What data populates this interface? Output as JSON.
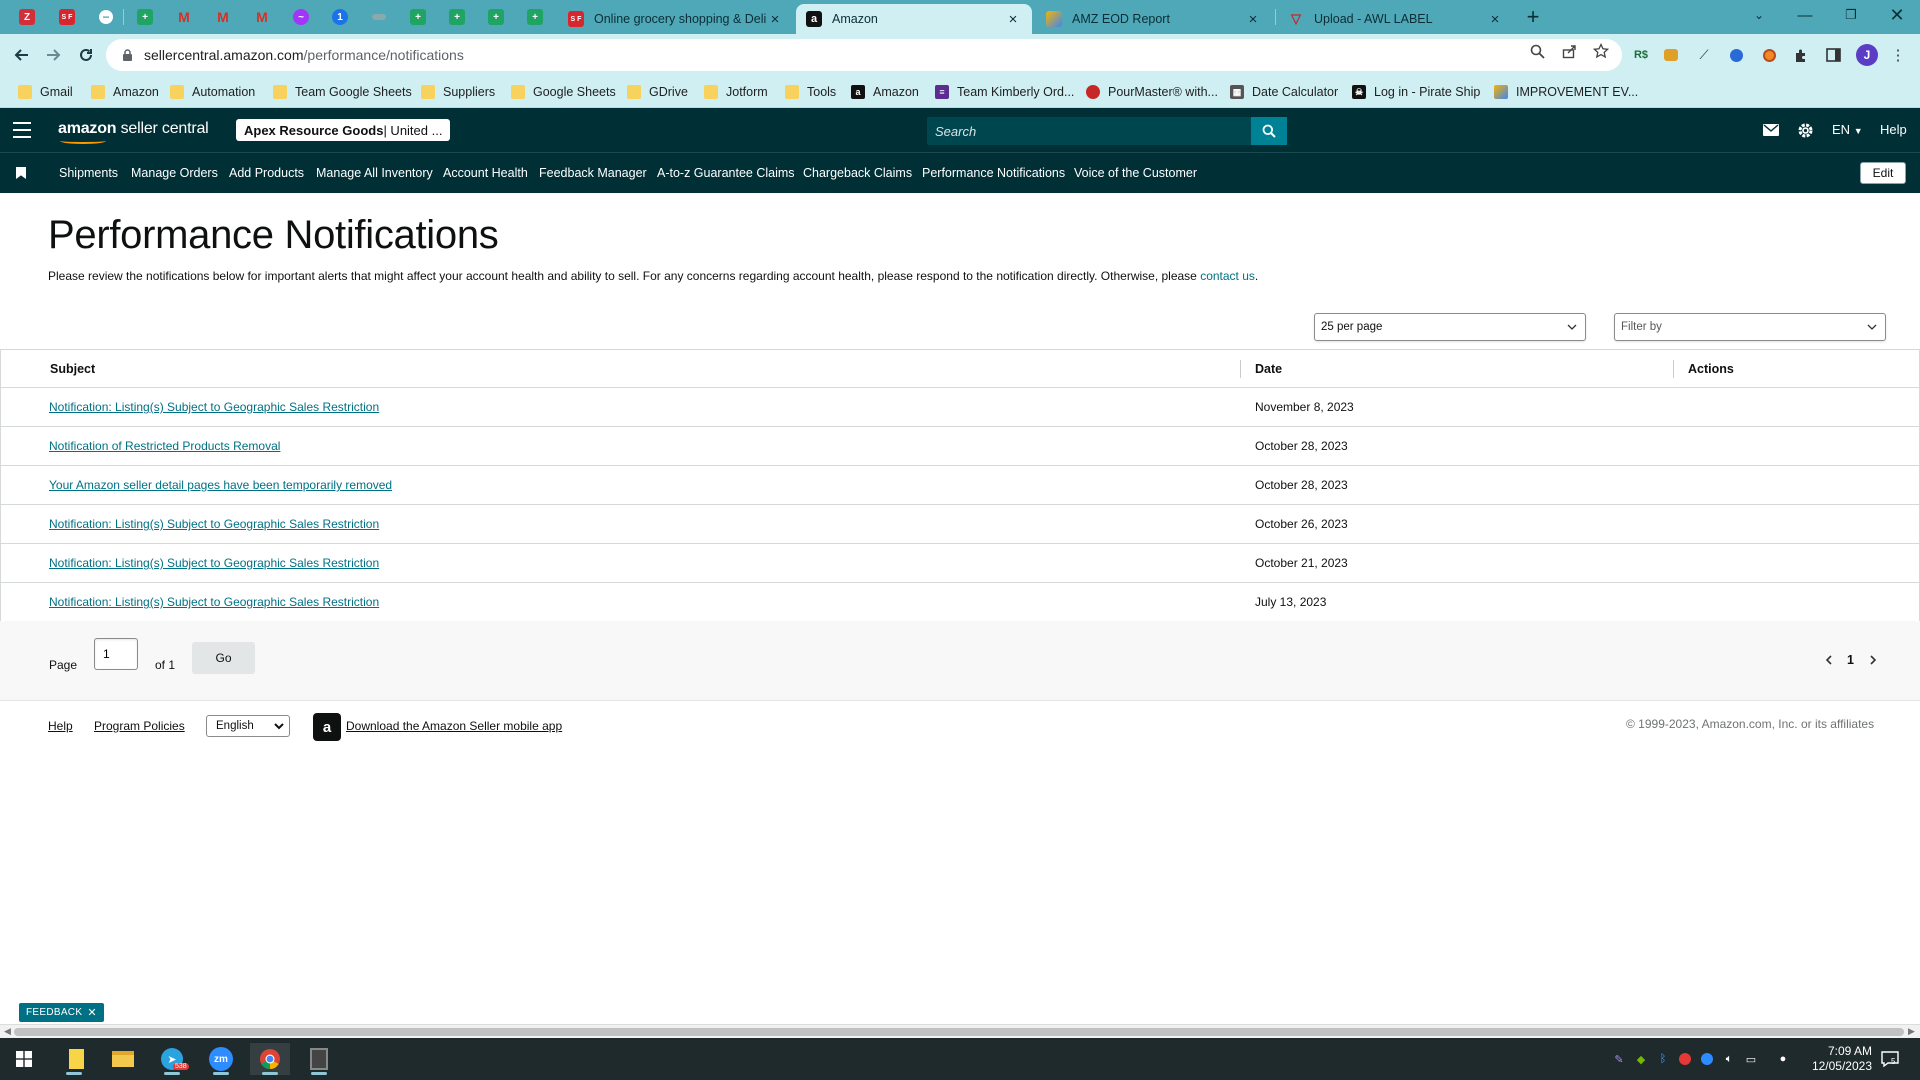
{
  "browser": {
    "tabs": [
      {
        "title": "Online grocery shopping & Deli",
        "favicon": "sf-icon"
      },
      {
        "title": "Amazon",
        "favicon": "amazon-icon",
        "active": true
      },
      {
        "title": "AMZ EOD Report",
        "favicon": "report-icon"
      },
      {
        "title": "Upload - AWL LABEL",
        "favicon": "upload-icon"
      }
    ],
    "pinned_badge": "S F",
    "url_domain": "sellercentral.amazon.com",
    "url_path": "/performance/notifications",
    "profile_initial": "J",
    "extension_badge": "R$",
    "bookmarks": [
      "Gmail",
      "Amazon",
      "Automation",
      "Team Google Sheets",
      "Suppliers",
      "Google Sheets",
      "GDrive",
      "Jotform",
      "Tools",
      "Amazon",
      "Team Kimberly Ord...",
      "PourMaster® with...",
      "Date Calculator",
      "Log in - Pirate Ship",
      "IMPROVEMENT EV..."
    ],
    "accent_color": "#4fa8b8"
  },
  "header": {
    "logo_strong": "amazon",
    "logo_rest": " seller central",
    "store_name": "Apex Resource Goods",
    "store_region": " | United ...",
    "search_placeholder": "Search",
    "language": "EN",
    "help": "Help",
    "bg_color": "#002f36"
  },
  "subnav": {
    "items": [
      "Shipments",
      "Manage Orders",
      "Add Products",
      "Manage All Inventory",
      "Account Health",
      "Feedback Manager",
      "A-to-z Guarantee Claims",
      "Chargeback Claims",
      "Performance Notifications",
      "Voice of the Customer"
    ],
    "edit": "Edit"
  },
  "main": {
    "title": "Performance Notifications",
    "intro": "Please review the notifications below for important alerts that might affect your account health and ability to sell. For any concerns regarding account health, please respond to the notification directly. Otherwise, please ",
    "intro_link": "contact us",
    "intro_end": ".",
    "per_page": "25 per page",
    "filter_placeholder": "Filter by",
    "columns": {
      "subject": "Subject",
      "date": "Date",
      "actions": "Actions"
    },
    "rows": [
      {
        "subject": "Notification: Listing(s) Subject to Geographic Sales Restriction",
        "date": "November 8, 2023"
      },
      {
        "subject": "Notification of Restricted Products Removal",
        "date": "October 28, 2023"
      },
      {
        "subject": "Your Amazon seller detail pages have been temporarily removed",
        "date": "October 28, 2023"
      },
      {
        "subject": "Notification: Listing(s) Subject to Geographic Sales Restriction",
        "date": "October 26, 2023"
      },
      {
        "subject": "Notification: Listing(s) Subject to Geographic Sales Restriction",
        "date": "October 21, 2023"
      },
      {
        "subject": "Notification: Listing(s) Subject to Geographic Sales Restriction",
        "date": "July 13, 2023"
      }
    ],
    "link_color": "#007185"
  },
  "pager": {
    "page_label": "Page",
    "page_value": "1",
    "of_label": "of 1",
    "go": "Go",
    "current": "1"
  },
  "footer": {
    "help": "Help",
    "policies": "Program Policies",
    "language": "English",
    "download_app": "Download the Amazon Seller mobile app",
    "copyright": "© 1999-2023, Amazon.com, Inc. or its affiliates"
  },
  "feedback": "FEEDBACK",
  "taskbar": {
    "time": "7:09 AM",
    "date": "12/05/2023",
    "telegram_badge": "538",
    "zoom_label": "zm",
    "notifications": "5"
  }
}
